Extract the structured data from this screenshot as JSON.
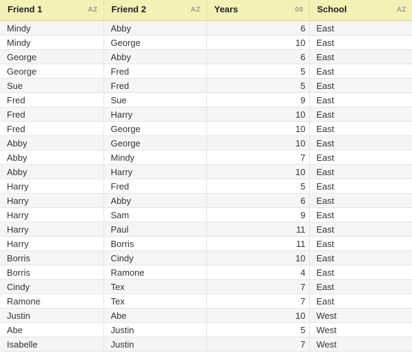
{
  "columns": [
    {
      "title": "Friend 1",
      "type_badge": "AZ"
    },
    {
      "title": "Friend 2",
      "type_badge": "AZ"
    },
    {
      "title": "Years",
      "type_badge": "09"
    },
    {
      "title": "School",
      "type_badge": "AZ"
    }
  ],
  "rows": [
    [
      "Mindy",
      "Abby",
      "6",
      "East"
    ],
    [
      "Mindy",
      "George",
      "10",
      "East"
    ],
    [
      "George",
      "Abby",
      "6",
      "East"
    ],
    [
      "George",
      "Fred",
      "5",
      "East"
    ],
    [
      "Sue",
      "Fred",
      "5",
      "East"
    ],
    [
      "Fred",
      "Sue",
      "9",
      "East"
    ],
    [
      "Fred",
      "Harry",
      "10",
      "East"
    ],
    [
      "Fred",
      "George",
      "10",
      "East"
    ],
    [
      "Abby",
      "George",
      "10",
      "East"
    ],
    [
      "Abby",
      "Mindy",
      "7",
      "East"
    ],
    [
      "Abby",
      "Harry",
      "10",
      "East"
    ],
    [
      "Harry",
      "Fred",
      "5",
      "East"
    ],
    [
      "Harry",
      "Abby",
      "6",
      "East"
    ],
    [
      "Harry",
      "Sam",
      "9",
      "East"
    ],
    [
      "Harry",
      "Paul",
      "11",
      "East"
    ],
    [
      "Harry",
      "Borris",
      "11",
      "East"
    ],
    [
      "Borris",
      "Cindy",
      "10",
      "East"
    ],
    [
      "Borris",
      "Ramone",
      "4",
      "East"
    ],
    [
      "Cindy",
      "Tex",
      "7",
      "East"
    ],
    [
      "Ramone",
      "Tex",
      "7",
      "East"
    ],
    [
      "Justin",
      "Abe",
      "10",
      "West"
    ],
    [
      "Abe",
      "Justin",
      "5",
      "West"
    ],
    [
      "Isabelle",
      "Justin",
      "7",
      "West"
    ]
  ],
  "colors": {
    "header_bg": "#f3f1b5",
    "row_alt_bg": "#f5f5f5",
    "grid_line": "#e4e4e4"
  }
}
